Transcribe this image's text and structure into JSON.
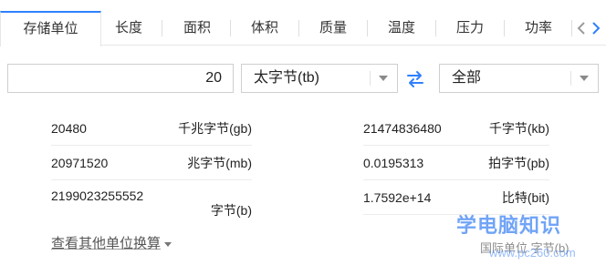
{
  "tabs": [
    {
      "label": "存储单位",
      "active": true
    },
    {
      "label": "长度",
      "active": false
    },
    {
      "label": "面积",
      "active": false
    },
    {
      "label": "体积",
      "active": false
    },
    {
      "label": "质量",
      "active": false
    },
    {
      "label": "温度",
      "active": false
    },
    {
      "label": "压力",
      "active": false
    },
    {
      "label": "功率",
      "active": false
    }
  ],
  "converter": {
    "input_value": "20",
    "from_unit": "太字节(tb)",
    "to_unit": "全部"
  },
  "results": {
    "left": [
      {
        "value": "20480",
        "unit": "千兆字节(gb)"
      },
      {
        "value": "20971520",
        "unit": "兆字节(mb)"
      },
      {
        "value": "2199023255552",
        "unit": "字节(b)"
      }
    ],
    "right": [
      {
        "value": "21474836480",
        "unit": "千字节(kb)"
      },
      {
        "value": "0.0195313",
        "unit": "拍字节(pb)"
      },
      {
        "value": "1.7592e+14",
        "unit": "比特(bit)"
      }
    ]
  },
  "more_link": "查看其他单位换算",
  "watermark": {
    "title": "学电脑知识",
    "partial_text": "国际单位 字节(b)",
    "site": "www.pc260.com"
  },
  "colors": {
    "accent": "#2f80ff",
    "border": "#cfcfcf"
  },
  "icons": {
    "swap": "swap-arrows-icon",
    "prev": "chevron-left-icon",
    "next": "chevron-right-icon",
    "dropdown": "caret-down-icon"
  }
}
